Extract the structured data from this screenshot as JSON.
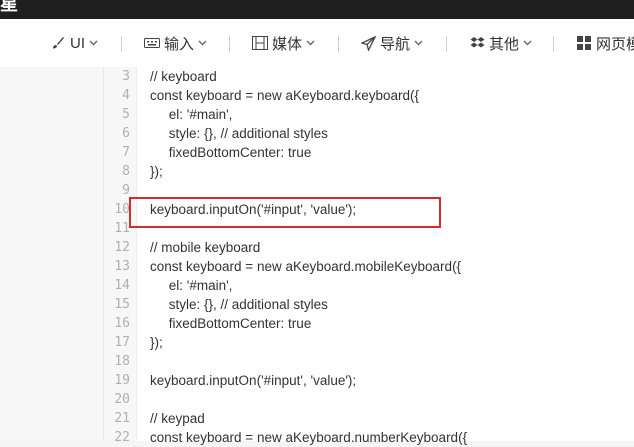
{
  "topbar": {
    "logo_fragment": "星"
  },
  "nav": {
    "items": [
      {
        "label": "UI",
        "icon": "brush-icon"
      },
      {
        "label": "输入",
        "icon": "keyboard-icon"
      },
      {
        "label": "媒体",
        "icon": "film-icon"
      },
      {
        "label": "导航",
        "icon": "paper-plane-icon"
      },
      {
        "label": "其他",
        "icon": "dropbox-icon"
      },
      {
        "label": "网页模",
        "icon": "grid-icon"
      }
    ]
  },
  "code": {
    "lines": [
      {
        "n": "3",
        "text": "// keyboard"
      },
      {
        "n": "4",
        "text": "const keyboard = new aKeyboard.keyboard({"
      },
      {
        "n": "5",
        "text": "     el: '#main',"
      },
      {
        "n": "6",
        "text": "     style: {}, // additional styles"
      },
      {
        "n": "7",
        "text": "     fixedBottomCenter: true"
      },
      {
        "n": "8",
        "text": "});"
      },
      {
        "n": "9",
        "text": ""
      },
      {
        "n": "10",
        "text": "keyboard.inputOn('#input', 'value');"
      },
      {
        "n": "11",
        "text": ""
      },
      {
        "n": "12",
        "text": "// mobile keyboard"
      },
      {
        "n": "13",
        "text": "const keyboard = new aKeyboard.mobileKeyboard({"
      },
      {
        "n": "14",
        "text": "     el: '#main',"
      },
      {
        "n": "15",
        "text": "     style: {}, // additional styles"
      },
      {
        "n": "16",
        "text": "     fixedBottomCenter: true"
      },
      {
        "n": "17",
        "text": "});"
      },
      {
        "n": "18",
        "text": ""
      },
      {
        "n": "19",
        "text": "keyboard.inputOn('#input', 'value');"
      },
      {
        "n": "20",
        "text": ""
      },
      {
        "n": "21",
        "text": "// keypad"
      },
      {
        "n": "22",
        "text": "const keyboard = new aKeyboard.numberKeyboard({"
      }
    ]
  },
  "colors": {
    "highlight": "#d62b2b",
    "topbar": "#1f1f1f"
  }
}
